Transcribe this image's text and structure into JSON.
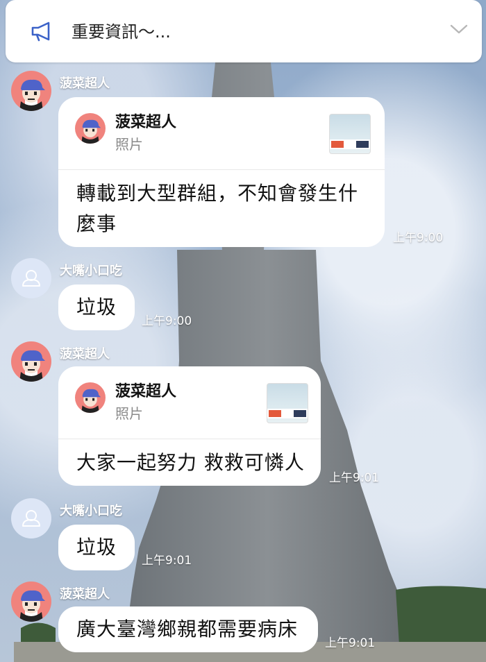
{
  "announcement": {
    "icon": "megaphone-icon",
    "text": "重要資訊～..."
  },
  "messages": [
    {
      "sender": "菠菜超人",
      "quote": {
        "name": "菠菜超人",
        "type": "照片"
      },
      "text_line1": "轉載到大型群組，不知會發生什",
      "text_line2": "麼事",
      "time": "上午9:00"
    },
    {
      "sender": "大嘴小口吃",
      "text": "垃圾",
      "time": "上午9:00"
    },
    {
      "sender": "菠菜超人",
      "quote": {
        "name": "菠菜超人",
        "type": "照片"
      },
      "text": "大家一起努力 救救可憐人",
      "time": "上午9:01"
    },
    {
      "sender": "大嘴小口吃",
      "text": "垃圾",
      "time": "上午9:01"
    },
    {
      "sender": "菠菜超人",
      "text": "廣大臺灣鄉親都需要病床",
      "time": "上午9:01"
    }
  ],
  "colors": {
    "avatar_bg": "#f0837d",
    "default_avatar_bg": "#dde6f6",
    "accent": "#3b62c8"
  }
}
